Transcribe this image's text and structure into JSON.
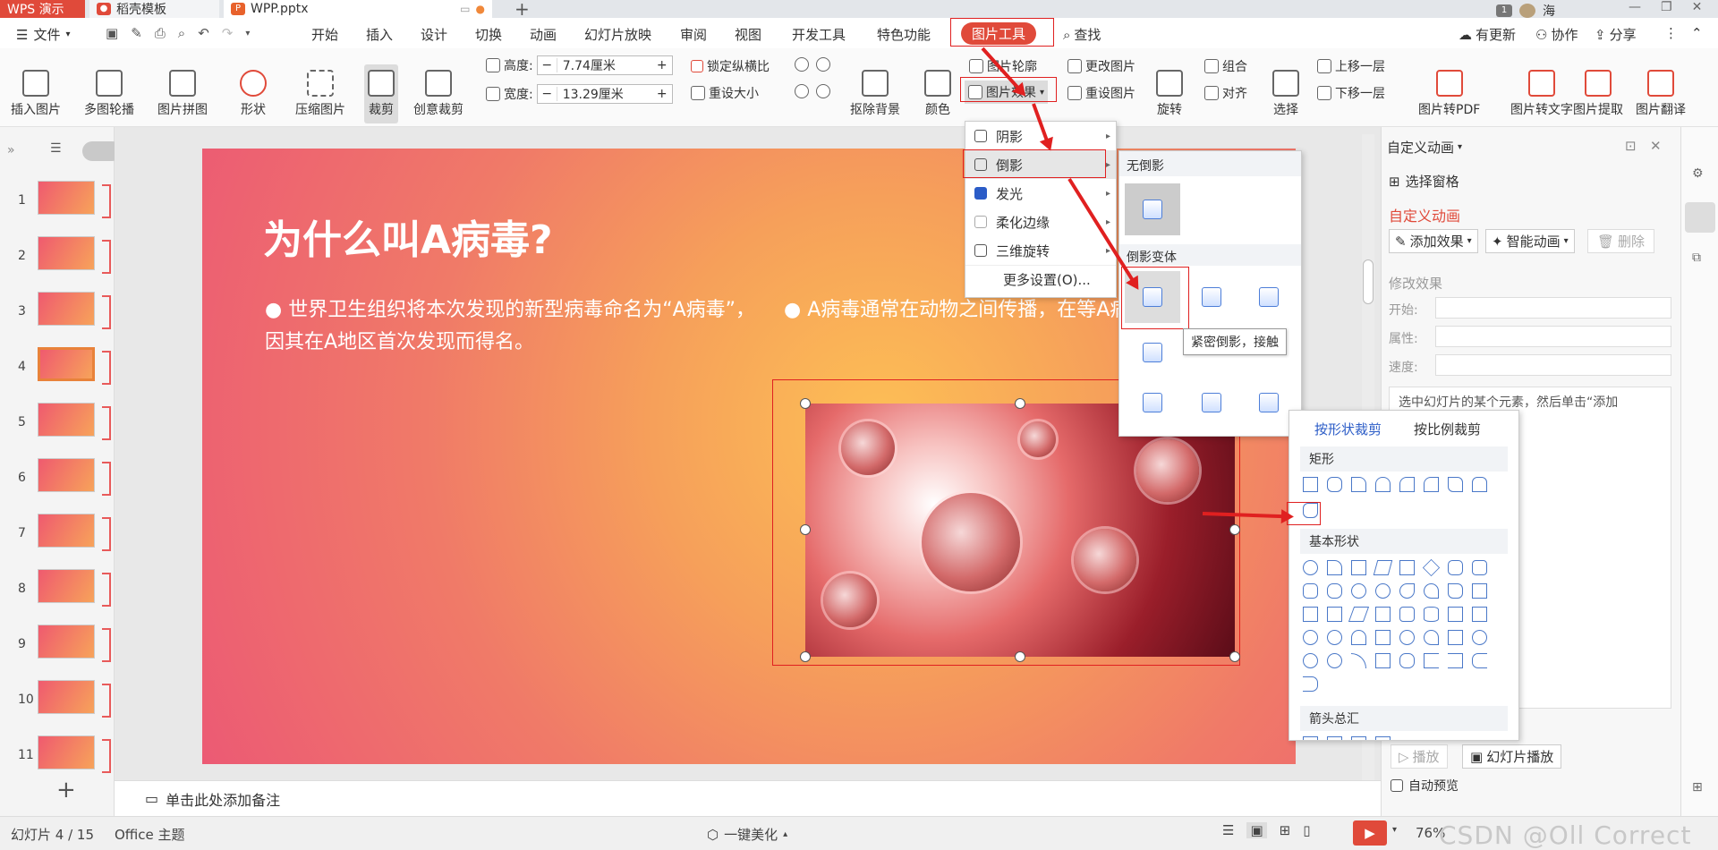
{
  "tabs": [
    {
      "label": "WPS 演示"
    },
    {
      "label": "稻壳模板"
    },
    {
      "label": "WPP.pptx"
    }
  ],
  "titlebar": {
    "notif": "1",
    "user": "海"
  },
  "menus": {
    "file": "文件",
    "items": [
      "开始",
      "插入",
      "设计",
      "切换",
      "动画",
      "幻灯片放映",
      "审阅",
      "视图",
      "开发工具",
      "特色功能"
    ],
    "active": "图片工具",
    "search": "查找",
    "update": "有更新",
    "collab": "协作",
    "share": "分享"
  },
  "ribbon": {
    "insert_pic": "插入图片",
    "multi_carousel": "多图轮播",
    "puzzle": "图片拼图",
    "shape": "形状",
    "compress": "压缩图片",
    "crop": "裁剪",
    "creative_crop": "创意裁剪",
    "height_label": "高度:",
    "height_value": "7.74厘米",
    "width_label": "宽度:",
    "width_value": "13.29厘米",
    "lock_ratio": "锁定纵横比",
    "reset_size": "重设大小",
    "remove_bg": "抠除背景",
    "color": "颜色",
    "pic_outline": "图片轮廓",
    "pic_effect": "图片效果",
    "change_pic": "更改图片",
    "reset_pic": "重设图片",
    "rotate": "旋转",
    "group": "组合",
    "align": "对齐",
    "select": "选择",
    "bring_forward": "上移一层",
    "send_backward": "下移一层",
    "to_pdf": "图片转PDF",
    "to_text": "图片转文字",
    "extract": "图片提取",
    "translate": "图片翻译"
  },
  "slides": [
    "1",
    "2",
    "3",
    "4",
    "5",
    "6",
    "7",
    "8",
    "9",
    "10",
    "11"
  ],
  "slide": {
    "title": "为什么叫A病毒?",
    "bullet1": "● 世界卫生组织将本次发现的新型病毒命名为“A病毒”，因其在A地区首次发现而得名。",
    "bullet2": "● A病毒通常在动物之间传播，在等A病毒进化并感染人类，然后在人"
  },
  "notes_placeholder": "单击此处添加备注",
  "effects_menu": {
    "items": [
      "阴影",
      "倒影",
      "发光",
      "柔化边缘",
      "三维旋转"
    ],
    "more": "更多设置(O)..."
  },
  "reflection_panel": {
    "none_label": "无倒影",
    "variants_label": "倒影变体",
    "tooltip": "紧密倒影，接触"
  },
  "crop_panel": {
    "tab_shape": "按形状裁剪",
    "tab_ratio": "按比例裁剪",
    "section_rect": "矩形",
    "section_basic": "基本形状",
    "section_arrows": "箭头总汇"
  },
  "right_panel": {
    "header": "自定义动画",
    "select_pane": "选择窗格",
    "title": "自定义动画",
    "add_effect": "添加效果",
    "smart_anim": "智能动画",
    "delete": "删除",
    "modify": "修改效果",
    "start": "开始:",
    "property": "属性:",
    "speed": "速度:",
    "hint": "选中幻灯片的某个元素，然后单击“添加",
    "play": "播放",
    "slideshow": "幻灯片播放",
    "auto_preview": "自动预览"
  },
  "status": {
    "slide_info": "幻灯片 4 / 15",
    "theme": "Office 主题",
    "beautify": "一键美化",
    "zoom": "76%",
    "watermark": "CSDN @Oll Correct"
  },
  "colors": {
    "accent": "#e04a3a",
    "highlight": "#e02020"
  }
}
